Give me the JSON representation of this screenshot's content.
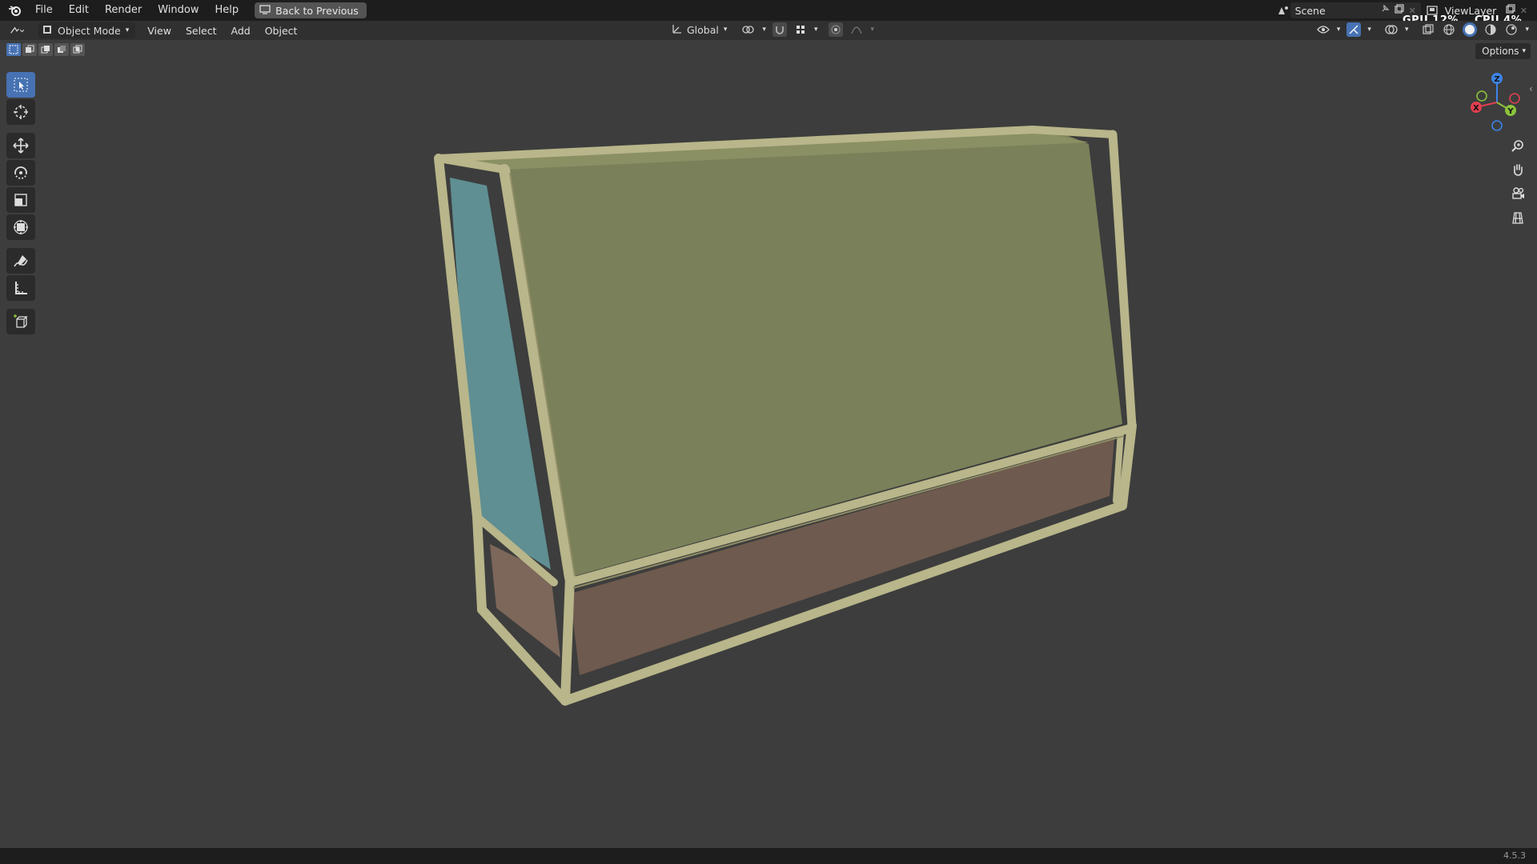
{
  "menubar": {
    "items": [
      "File",
      "Edit",
      "Render",
      "Window",
      "Help"
    ],
    "back_button": "Back to Previous"
  },
  "scene": {
    "name": "Scene"
  },
  "view_layer": {
    "name": "ViewLayer"
  },
  "hud": {
    "gpu": "GPU 12%",
    "cpu": "CPU 4%"
  },
  "header": {
    "mode": "Object Mode",
    "menus": [
      "View",
      "Select",
      "Add",
      "Object"
    ],
    "orientation": "Global"
  },
  "options_label": "Options",
  "gizmo": {
    "x": "X",
    "y": "Y",
    "z": "Z"
  },
  "version": "4.5.3",
  "colors": {
    "accent": "#4772b3",
    "frame": "#b8b68a",
    "top_panel": "#7a8059",
    "side_glass": "#5f8f92",
    "bottom_panel": "#6e5a4e",
    "axis_x": "#e0404f",
    "axis_y": "#8ac33b",
    "axis_z": "#3d84e6"
  }
}
